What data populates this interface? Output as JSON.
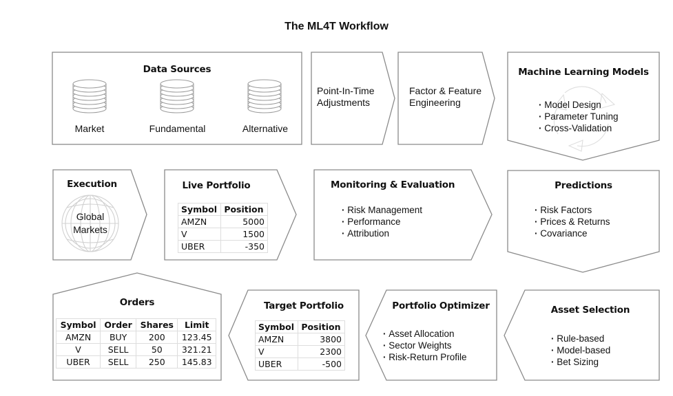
{
  "title": "The ML4T Workflow",
  "data_sources": {
    "heading": "Data Sources",
    "sources": [
      {
        "label": "Market",
        "icon": "database-icon"
      },
      {
        "label": "Fundamental",
        "icon": "database-icon"
      },
      {
        "label": "Alternative",
        "icon": "database-icon"
      }
    ]
  },
  "point_in_time": {
    "lines": [
      "Point-In-Time",
      "Adjustments"
    ]
  },
  "factor_engineering": {
    "lines": [
      "Factor & Feature",
      "Engineering"
    ]
  },
  "ml_models": {
    "heading": "Machine Learning Models",
    "items": [
      "Model Design",
      "Parameter Tuning",
      "Cross-Validation"
    ],
    "icon": "cycle-arrows-icon"
  },
  "execution": {
    "heading": "Execution",
    "lines": [
      "Global",
      "Markets"
    ],
    "icon": "globe-icon"
  },
  "live_portfolio": {
    "heading": "Live Portfolio",
    "columns": [
      "Symbol",
      "Position"
    ],
    "rows": [
      [
        "AMZN",
        "5000"
      ],
      [
        "V",
        "1500"
      ],
      [
        "UBER",
        "-350"
      ]
    ]
  },
  "monitoring": {
    "heading": "Monitoring & Evaluation",
    "items": [
      "Risk Management",
      "Performance",
      "Attribution"
    ]
  },
  "predictions": {
    "heading": "Predictions",
    "items": [
      "Risk Factors",
      "Prices & Returns",
      "Covariance"
    ]
  },
  "orders": {
    "heading": "Orders",
    "columns": [
      "Symbol",
      "Order",
      "Shares",
      "Limit"
    ],
    "rows": [
      [
        "AMZN",
        "BUY",
        "200",
        "123.45"
      ],
      [
        "V",
        "SELL",
        "50",
        "321.21"
      ],
      [
        "UBER",
        "SELL",
        "250",
        "145.83"
      ]
    ]
  },
  "target_portfolio": {
    "heading": "Target Portfolio",
    "columns": [
      "Symbol",
      "Position"
    ],
    "rows": [
      [
        "AMZN",
        "3800"
      ],
      [
        "V",
        "2300"
      ],
      [
        "UBER",
        "-500"
      ]
    ]
  },
  "optimizer": {
    "heading": "Portfolio Optimizer",
    "items": [
      "Asset Allocation",
      "Sector Weights",
      "Risk-Return Profile"
    ]
  },
  "asset_selection": {
    "heading": "Asset Selection",
    "items": [
      "Rule-based",
      "Model-based",
      "Bet Sizing"
    ]
  },
  "colors": {
    "stroke": "#8a8a8a",
    "text": "#111111",
    "icon": "#b5b5b5",
    "faint_icon": "#dddddd"
  }
}
